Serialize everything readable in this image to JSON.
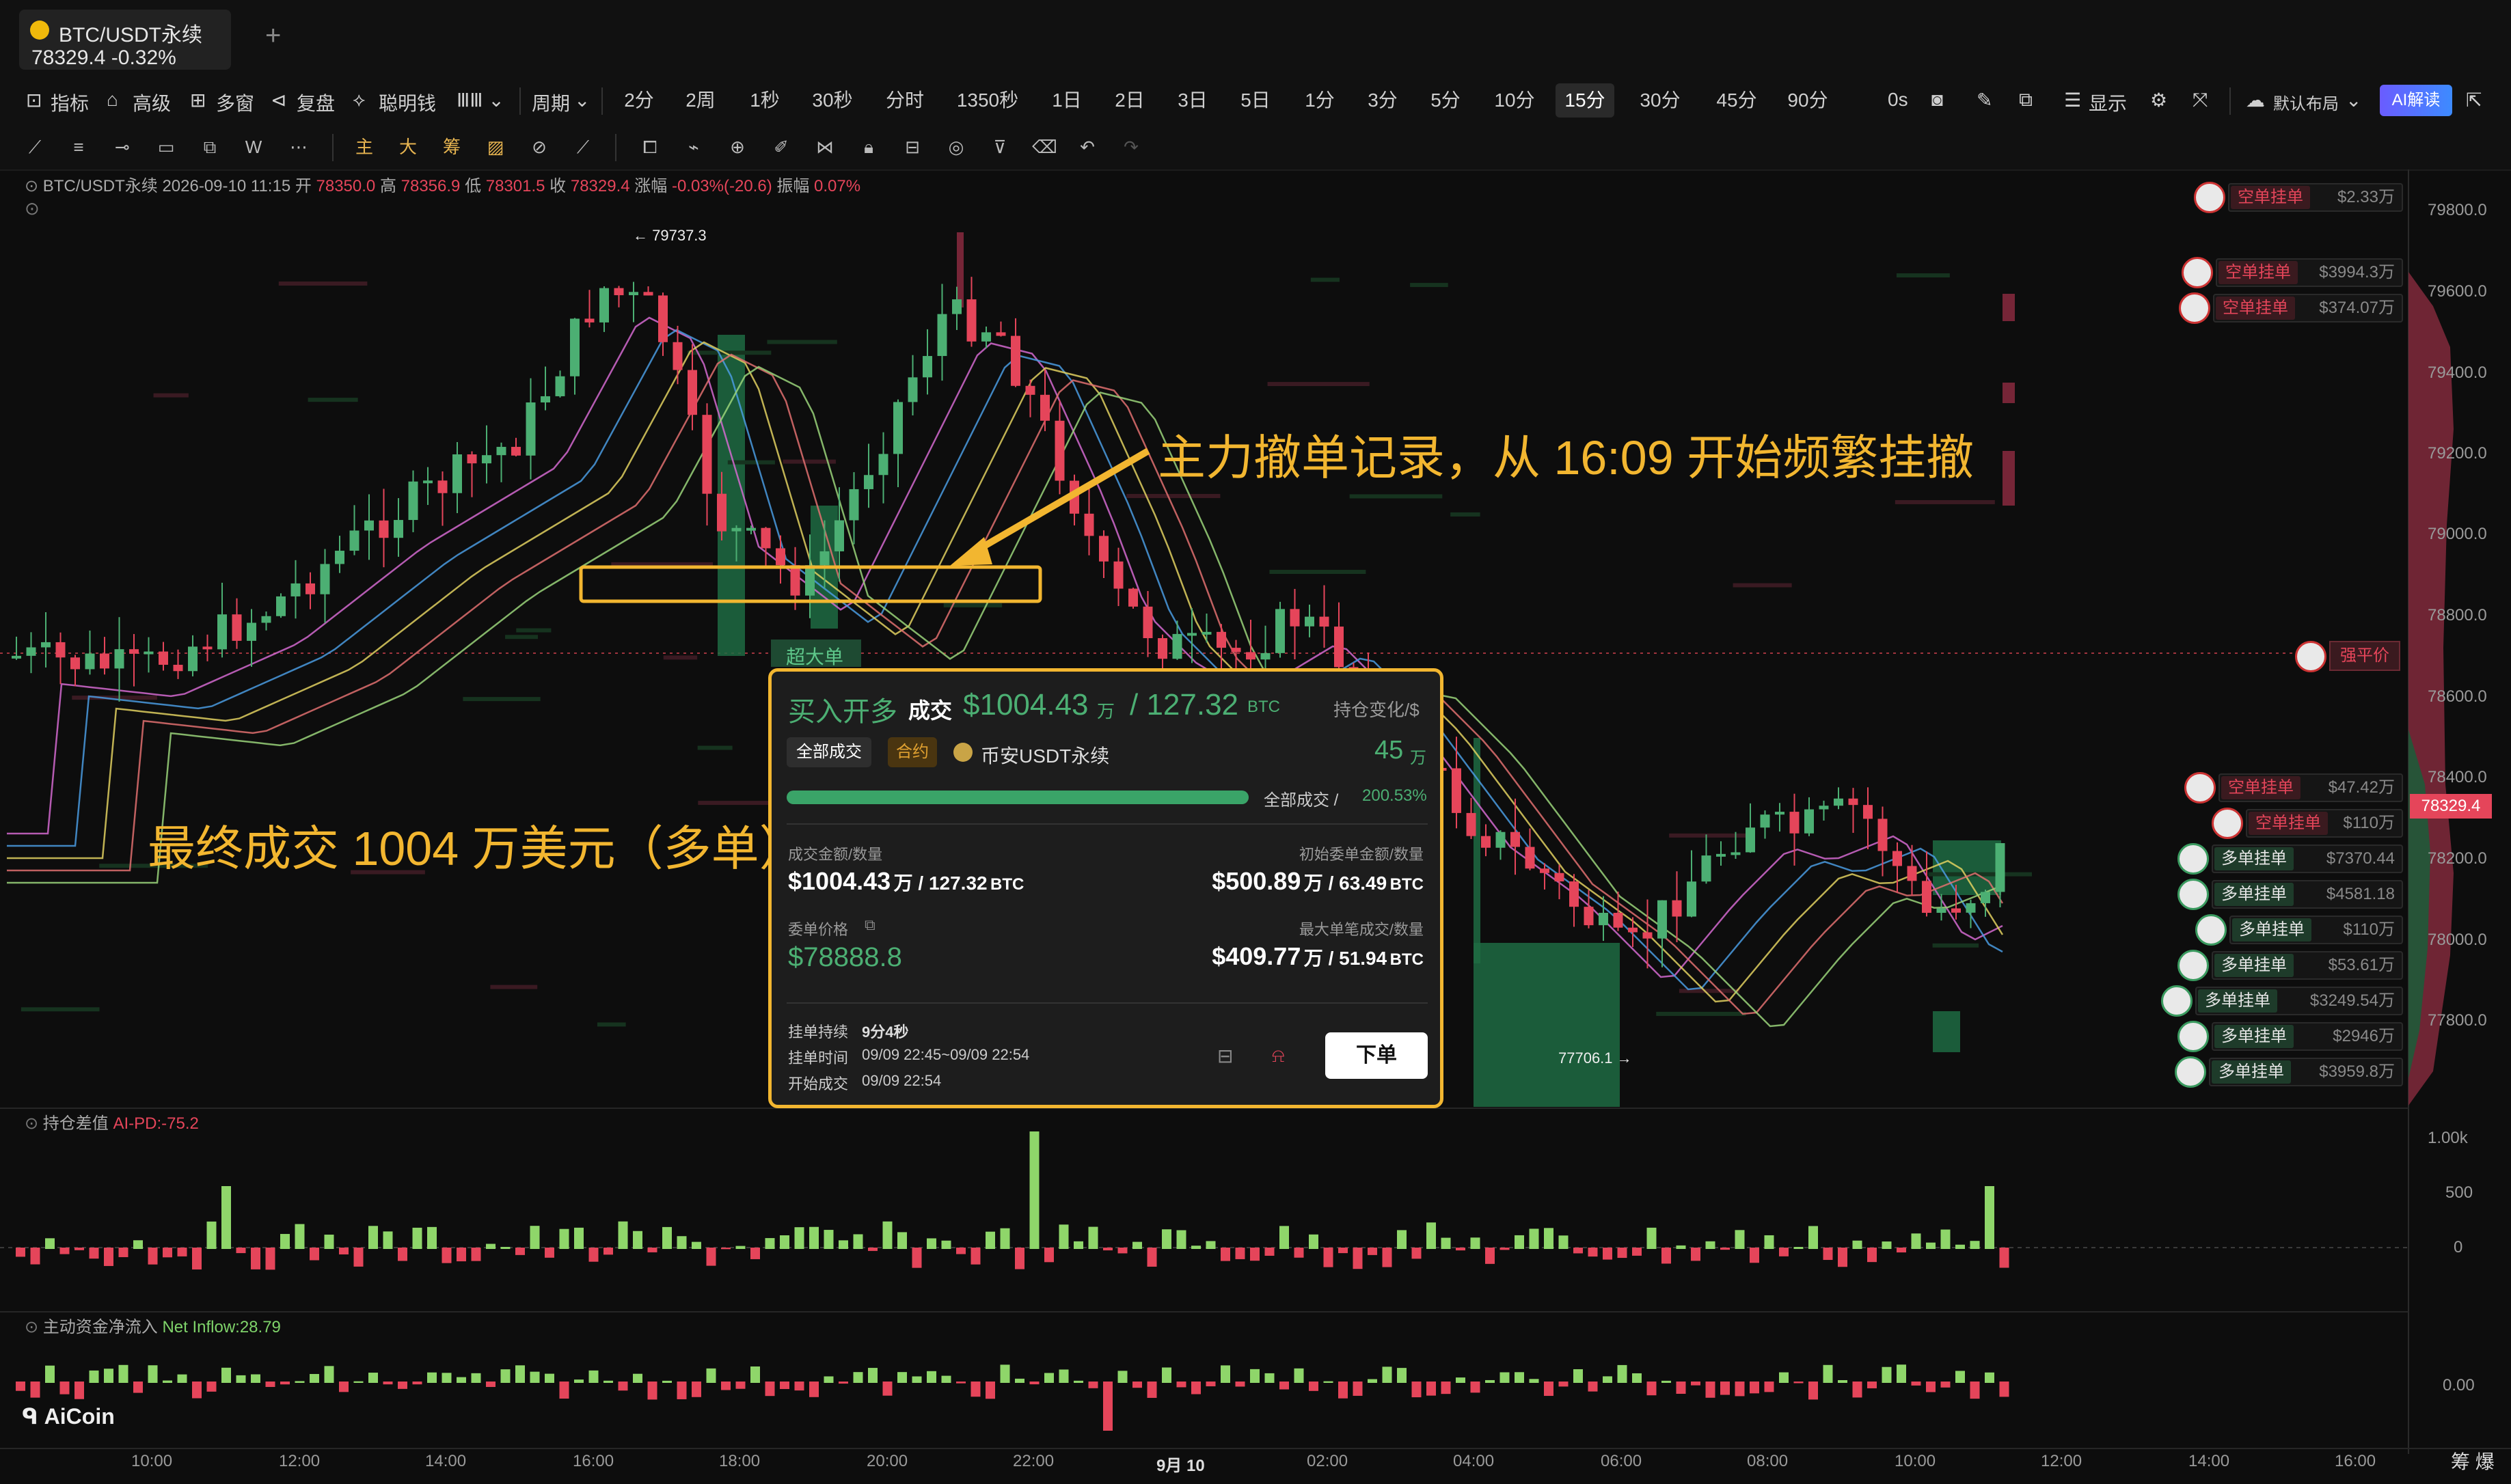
{
  "tab": {
    "name": "BTC/USDT永续",
    "price": "78329.4  -0.32%",
    "add": "+"
  },
  "toolbar": {
    "items": [
      "指标",
      "高级",
      "多窗",
      "复盘",
      "聪明钱",
      "周期"
    ],
    "periods": [
      "2分",
      "2周",
      "1秒",
      "30秒",
      "分时",
      "1350秒",
      "1日",
      "2日",
      "3日",
      "5日",
      "1分",
      "3分",
      "5分",
      "10分",
      "15分",
      "30分",
      "45分",
      "90分"
    ],
    "active_period": "15分",
    "right": [
      "0s",
      "显示",
      "默认布局"
    ],
    "ai": "AI解读"
  },
  "tools": [
    "主",
    "大",
    "筹"
  ],
  "info": {
    "symbol": "BTC/USDT永续",
    "datetime": "2026-09-10 11:15",
    "open_label": "开",
    "open": "78350.0",
    "high_label": "高",
    "high": "78356.9",
    "low_label": "低",
    "low": "78301.5",
    "close_label": "收",
    "close": "78329.4",
    "change_label": "涨幅",
    "change": "-0.03%(-20.6)",
    "amp_label": "振幅",
    "amp": "0.07%"
  },
  "y_axis": [
    "79800.0",
    "79600.0",
    "79400.0",
    "79200.0",
    "79000.0",
    "78800.0",
    "78600.0",
    "78400.0",
    "78200.0",
    "78000.0",
    "77800.0"
  ],
  "current_price": "78329.4",
  "x_axis": [
    "10:00",
    "12:00",
    "14:00",
    "16:00",
    "18:00",
    "20:00",
    "22:00",
    "9月 10",
    "02:00",
    "04:00",
    "06:00",
    "08:00",
    "10:00",
    "12:00",
    "14:00",
    "16:00"
  ],
  "high_marker": "79737.3",
  "low_marker": "77706.1",
  "super_order": "超大单",
  "liquidation": "强平价",
  "orders": [
    {
      "label": "空单挂单",
      "value": "$2.33万",
      "side": "short"
    },
    {
      "label": "空单挂单",
      "value": "$3994.3万",
      "side": "short"
    },
    {
      "label": "空单挂单",
      "value": "$374.07万",
      "side": "short"
    },
    {
      "label": "空单挂单",
      "value": "$47.42万",
      "side": "short"
    },
    {
      "label": "空单挂单",
      "value": "$110万",
      "side": "short"
    },
    {
      "label": "多单挂单",
      "value": "$7370.44",
      "side": "long"
    },
    {
      "label": "多单挂单",
      "value": "$4581.18",
      "side": "long"
    },
    {
      "label": "多单挂单",
      "value": "$110万",
      "side": "long"
    },
    {
      "label": "多单挂单",
      "value": "$53.61万",
      "side": "long"
    },
    {
      "label": "多单挂单",
      "value": "$3249.54万",
      "side": "long"
    },
    {
      "label": "多单挂单",
      "value": "$2946万",
      "side": "long"
    },
    {
      "label": "多单挂单",
      "value": "$3959.8万",
      "side": "long"
    }
  ],
  "annotations": {
    "a1": "主力撤单记录，从 16:09 开始频繁挂撤",
    "a2": "最终成交 1004 万美元（多单）"
  },
  "popup": {
    "title": "买入开多",
    "deal": "成交",
    "amount": "$1004.43",
    "amount_unit": "万",
    "qty": "/ 127.32",
    "qty_unit": "BTC",
    "pos_change_label": "持仓变化/$",
    "tab_all": "全部成交",
    "tab_contract": "合约",
    "exchange": "币安USDT永续",
    "pos_change": "45",
    "pos_change_unit": "万",
    "progress_label": "全部成交 /",
    "progress_pct": "200.53%",
    "progress_fraction": 1.0,
    "deal_amount_label": "成交金额/数量",
    "deal_amount": "$1004.43",
    "deal_amount_rest": "万 / 127.32",
    "deal_amount_unit": "BTC",
    "init_label": "初始委单金额/数量",
    "init_amount": "$500.89",
    "init_rest": "万 / 63.49",
    "init_unit": "BTC",
    "price_label": "委单价格",
    "price": "$78888.8",
    "max_label": "最大单笔成交/数量",
    "max_amount": "$409.77",
    "max_rest": "万 / 51.94",
    "max_unit": "BTC",
    "dur_label": "挂单持续",
    "dur": "9分4秒",
    "time_label": "挂单时间",
    "time": "09/09 22:45~09/09 22:54",
    "start_label": "开始成交",
    "start": "09/09 22:54",
    "order_btn": "下单"
  },
  "sub1": {
    "title": "持仓差值",
    "value": "AI-PD:-75.2",
    "ticks": [
      "1.00k",
      "500",
      "0"
    ]
  },
  "sub2": {
    "title": "主动资金净流入",
    "value": "Net Inflow:28.79",
    "ticks": [
      "0.00"
    ]
  },
  "logo": "AiCoin",
  "corner": "筹 爆",
  "colors": {
    "up": "#4caf73",
    "down": "#e5455a",
    "accent": "#f2b630"
  }
}
